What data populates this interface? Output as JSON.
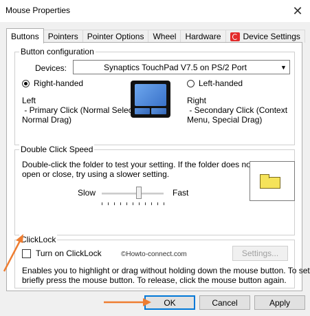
{
  "window": {
    "title": "Mouse Properties",
    "close_glyph": "✕"
  },
  "tabs": [
    {
      "label": "Buttons",
      "active": true
    },
    {
      "label": "Pointers"
    },
    {
      "label": "Pointer Options"
    },
    {
      "label": "Wheel"
    },
    {
      "label": "Hardware"
    },
    {
      "label": "Device Settings",
      "icon": "synaptics-icon"
    }
  ],
  "button_config": {
    "legend": "Button configuration",
    "devices_label": "Devices:",
    "device_selected": "Synaptics TouchPad V7.5 on PS/2 Port",
    "right_handed": {
      "label": "Right-handed",
      "selected": true
    },
    "left_handed": {
      "label": "Left-handed",
      "selected": false
    },
    "left_desc_title": "Left",
    "left_desc_lines": [
      " - Primary Click (Normal Select,",
      "Normal Drag)"
    ],
    "right_desc_title": "Right",
    "right_desc_lines": [
      " - Secondary Click (Context",
      "Menu, Special Drag)"
    ]
  },
  "double_click": {
    "legend": "Double Click Speed",
    "desc_lines": [
      "Double-click the folder to test your setting.  If the folder does not",
      "open or close, try using a slower setting."
    ],
    "slow_label": "Slow",
    "fast_label": "Fast",
    "speed_level": 0.6
  },
  "clicklock": {
    "legend": "ClickLock",
    "checkbox_label": "Turn on ClickLock",
    "checked": false,
    "settings_label": "Settings...",
    "watermark": "©Howto-connect.com",
    "desc_lines": [
      "Enables you to highlight or drag without holding down the mouse button.  To set,",
      "briefly press the mouse button.  To release, click the mouse button again."
    ]
  },
  "footer": {
    "ok_label": "OK",
    "cancel_label": "Cancel",
    "apply_label": "Apply"
  },
  "colors": {
    "annotation_arrow": "#ee7d31",
    "accent": "#0078d7"
  }
}
